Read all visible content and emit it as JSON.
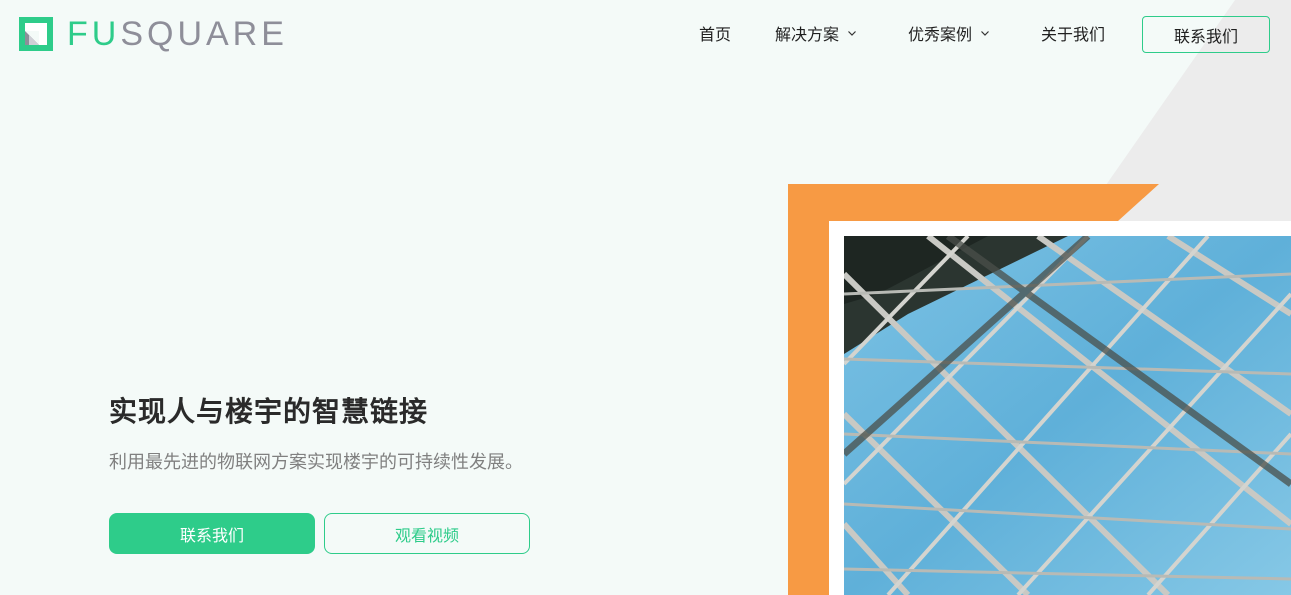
{
  "brand": {
    "logo_prefix": "FU",
    "logo_suffix": "SQUARE",
    "accent": "#2ecc8a",
    "logo_gray": "#8e8e99",
    "orange": "#f79a44"
  },
  "nav": {
    "items": [
      {
        "label": "首页",
        "has_dropdown": false
      },
      {
        "label": "解决方案",
        "has_dropdown": true
      },
      {
        "label": "优秀案例",
        "has_dropdown": true
      },
      {
        "label": "关于我们",
        "has_dropdown": false
      }
    ],
    "cta_label": "联系我们"
  },
  "hero": {
    "title": "实现人与楼宇的智慧链接",
    "subtitle": "利用最先进的物联网方案实现楼宇的可持续性发展。",
    "primary_button": "联系我们",
    "secondary_button": "观看视频",
    "image_subject": "glass-roof-skylight"
  }
}
